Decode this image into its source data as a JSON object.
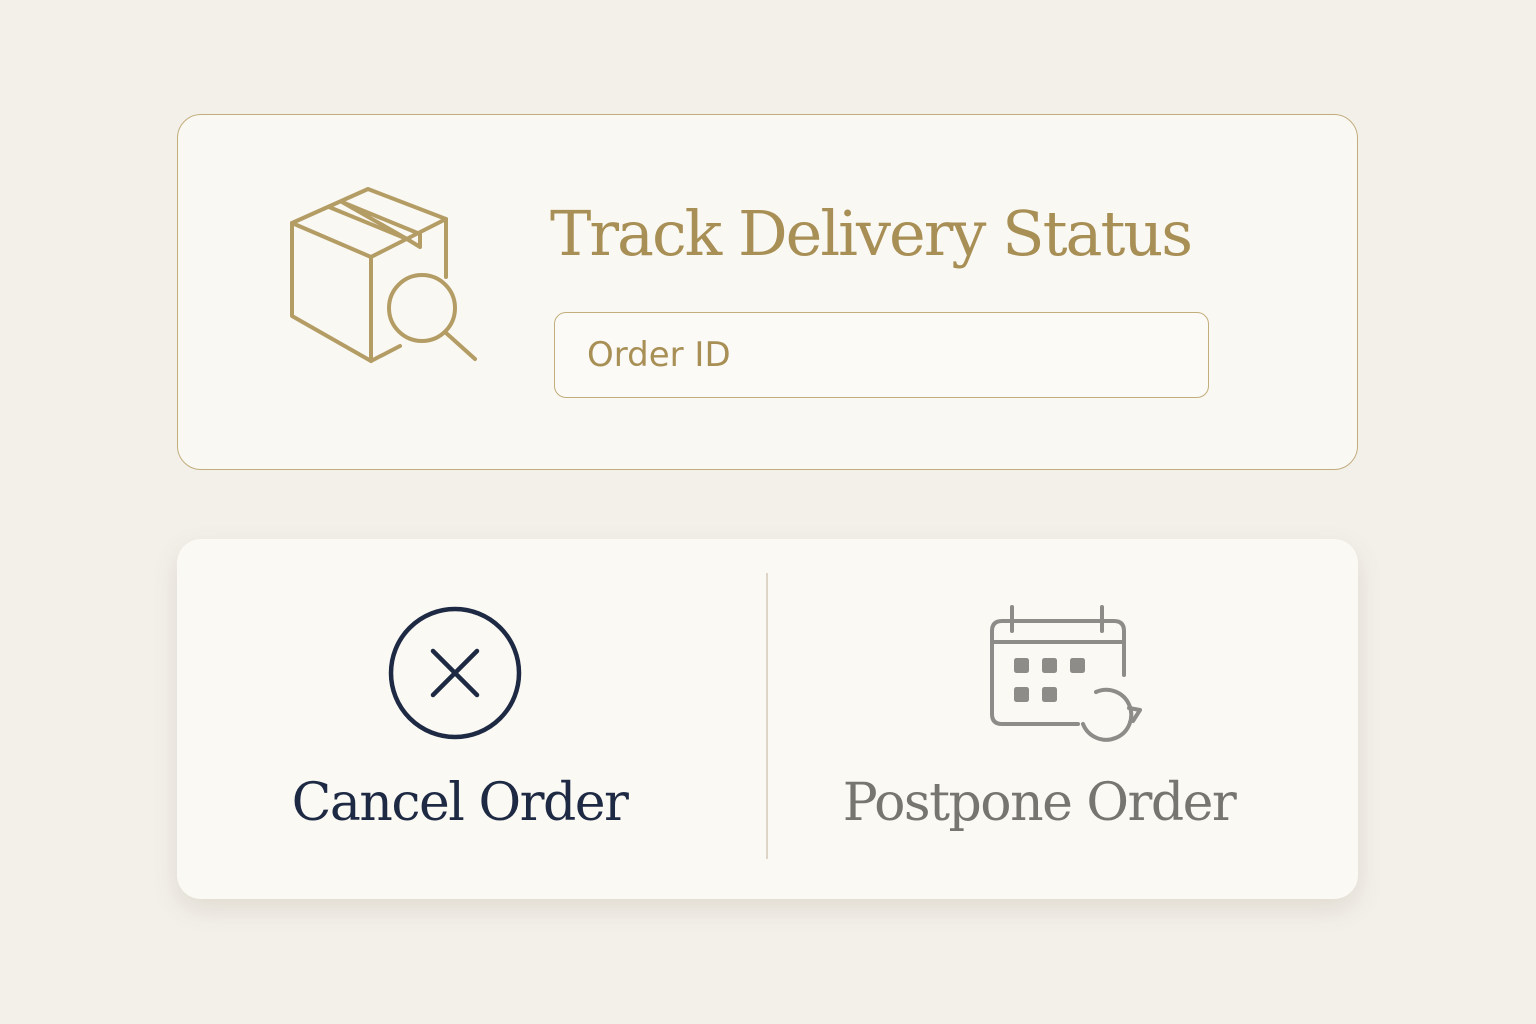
{
  "track": {
    "title": "Track Delivery Status",
    "input_placeholder": "Order ID",
    "input_value": "",
    "icon": "package-search-icon"
  },
  "actions": {
    "cancel": {
      "label": "Cancel Order",
      "icon": "close-circle-icon"
    },
    "postpone": {
      "label": "Postpone Order",
      "icon": "calendar-reschedule-icon"
    }
  },
  "colors": {
    "background": "#f3f0ea",
    "card": "#faf8f2",
    "gold": "#a88f55",
    "gold_border": "#c2ad7c",
    "navy": "#1e2a44",
    "gray": "#777570",
    "icon_gray": "#8d8c88"
  }
}
